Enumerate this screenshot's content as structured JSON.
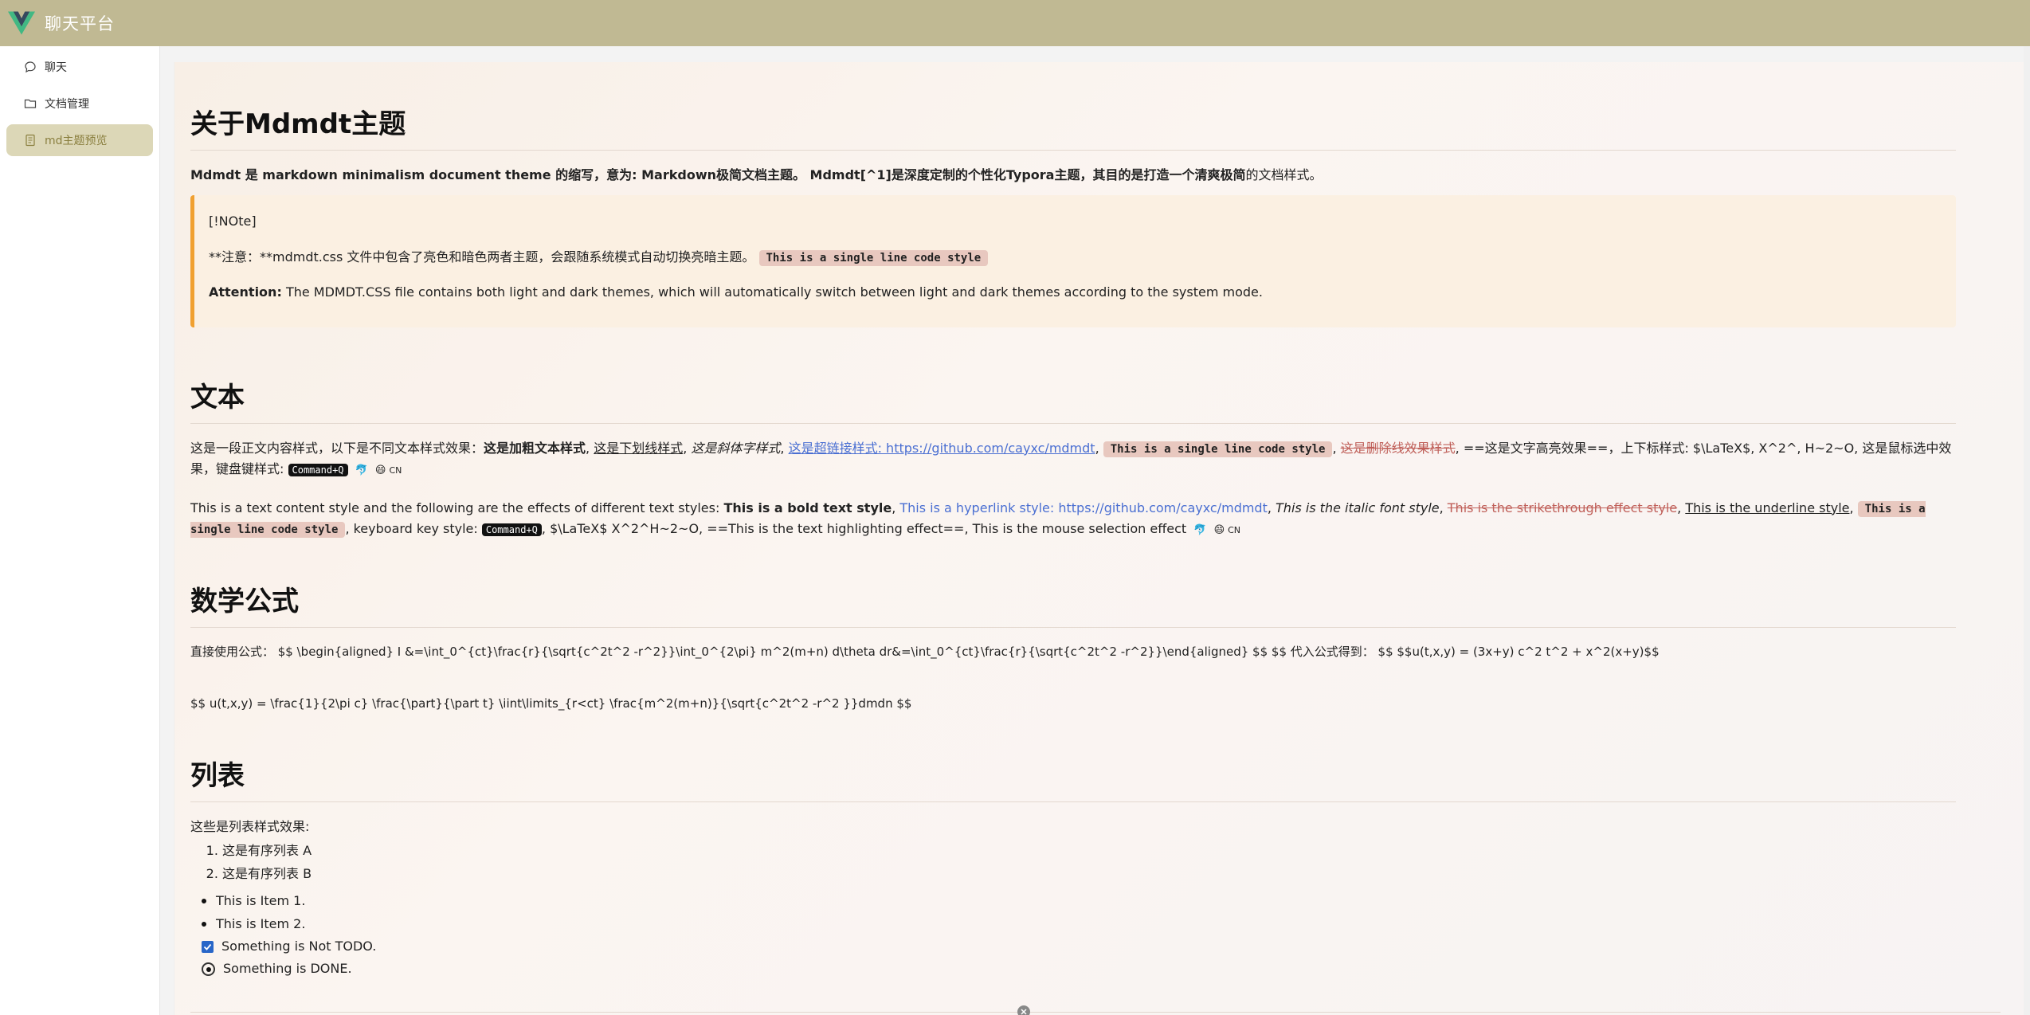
{
  "app": {
    "title": "聊天平台"
  },
  "sidebar": {
    "items": [
      {
        "label": "聊天",
        "icon": "chat-bubble-icon",
        "active": false
      },
      {
        "label": "文档管理",
        "icon": "folder-icon",
        "active": false
      },
      {
        "label": "md主题预览",
        "icon": "document-icon",
        "active": true
      }
    ]
  },
  "doc": {
    "h_about": "关于Mdmdt主题",
    "about_p_bold1": "Mdmdt 是 markdown minimalism document theme 的缩写，意为: Markdown极简文档主题。 Mdmdt[^1]是深度定制的个性化Typora主题，其目的是打造一个清爽极简",
    "about_p_rest": "的文档样式。",
    "note_title": "[!NOte]",
    "note_cn": "**注意：**mdmdt.css 文件中包含了亮色和暗色两者主题，会跟随系统模式自动切换亮暗主题。",
    "note_code": "This is a single line code style",
    "note_en_bold": "Attention:",
    "note_en": "The MDMDT.CSS file contains both light and dark themes, which will automatically switch between light and dark themes according to the system mode.",
    "h_text": "文本",
    "text_cn_1": "这是一段正文内容样式，以下是不同文本样式效果：",
    "text_cn_bold": "这是加粗文本样式",
    "text_cn_underline": "这是下划线样式",
    "text_cn_italic": "这是斜体字样式",
    "text_cn_link": "这是超链接样式: https://github.com/cayxc/mdmdt",
    "text_cn_code": "This is a single line code style",
    "text_cn_strike": "这是删除线效果样式",
    "text_cn_2": "==这是文字高亮效果==，上下标样式: $\\LaTeX$, X^2^, H~2~O, 这是鼠标选中效果，键盘键样式:",
    "kbd": "Command+Q",
    "cn_badge": "CN",
    "text_en_1": "This is a text content style and the following are the effects of different text styles:",
    "text_en_bold": "This is a bold text style",
    "text_en_link": "This is a hyperlink style: https://github.com/cayxc/mdmdt",
    "text_en_italic": "This is the italic font style",
    "text_en_strike": "This is the strikethrough effect style",
    "text_en_underline": "This is the underline style",
    "text_en_code": "This is a single line code style",
    "text_en_2": "keyboard key style:",
    "text_en_3": ", $\\LaTeX$ X^2^H~2~O, ==This is the text highlighting effect==, This is the mouse selection effect",
    "h_math": "数学公式",
    "math_1": "直接使用公式：  $$ \\begin{aligned} I &=\\int_0^{ct}\\frac{r}{\\sqrt{c^2t^2 -r^2}}\\int_0^{2\\pi} m^2(m+n) d\\theta dr&=\\int_0^{ct}\\frac{r}{\\sqrt{c^2t^2 -r^2}}\\end{aligned} $$ $$ 代入公式得到：  $$ $$u(t,x,y) = (3x+y) c^2 t^2 + x^2(x+y)$$",
    "math_2": "$$ u(t,x,y) = \\frac{1}{2\\pi c} \\frac{\\part}{\\part t} \\iint\\limits_{r<ct} \\frac{m^2(m+n)}{\\sqrt{c^2t^2 -r^2 }}dmdn $$",
    "h_list": "列表",
    "list_intro": "这些是列表样式效果:",
    "ordered": [
      "这是有序列表 A",
      "这是有序列表 B"
    ],
    "bullets": [
      "This is Item 1.",
      "This is Item 2."
    ],
    "task_todo": "Something is Not TODO.",
    "task_done": "Something is DONE."
  },
  "colors": {
    "topbar": "#c0b993",
    "active_bg": "#dcd7b7",
    "accent": "#f0a030",
    "link": "#4a6fd2"
  }
}
